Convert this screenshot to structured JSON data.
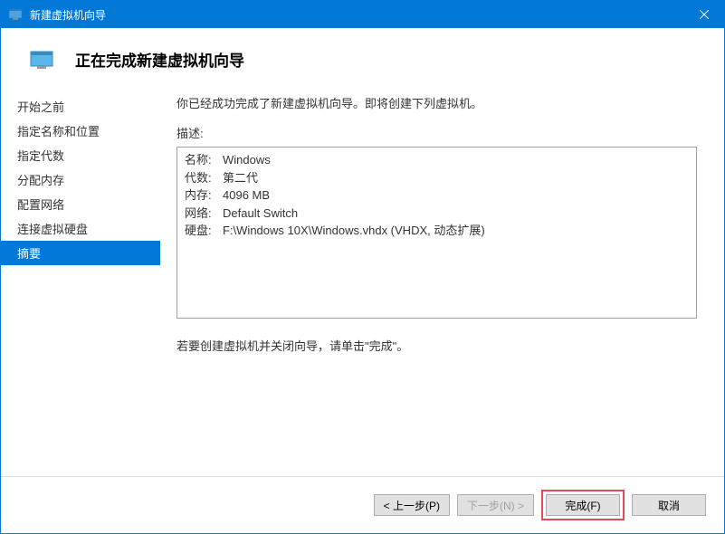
{
  "titlebar": {
    "title": "新建虚拟机向导"
  },
  "header": {
    "title": "正在完成新建虚拟机向导"
  },
  "sidebar": {
    "items": [
      {
        "label": "开始之前"
      },
      {
        "label": "指定名称和位置"
      },
      {
        "label": "指定代数"
      },
      {
        "label": "分配内存"
      },
      {
        "label": "配置网络"
      },
      {
        "label": "连接虚拟硬盘"
      },
      {
        "label": "摘要"
      }
    ],
    "active_index": 6
  },
  "main": {
    "intro": "你已经成功完成了新建虚拟机向导。即将创建下列虚拟机。",
    "description_label": "描述:",
    "details": [
      {
        "label": "名称:",
        "value": "Windows"
      },
      {
        "label": "代数:",
        "value": "第二代"
      },
      {
        "label": "内存:",
        "value": "4096 MB"
      },
      {
        "label": "网络:",
        "value": "Default Switch"
      },
      {
        "label": "硬盘:",
        "value": "F:\\Windows 10X\\Windows.vhdx (VHDX, 动态扩展)"
      }
    ],
    "instruction": "若要创建虚拟机并关闭向导，请单击\"完成\"。"
  },
  "buttons": {
    "previous": "< 上一步(P)",
    "next": "下一步(N) >",
    "finish": "完成(F)",
    "cancel": "取消"
  }
}
